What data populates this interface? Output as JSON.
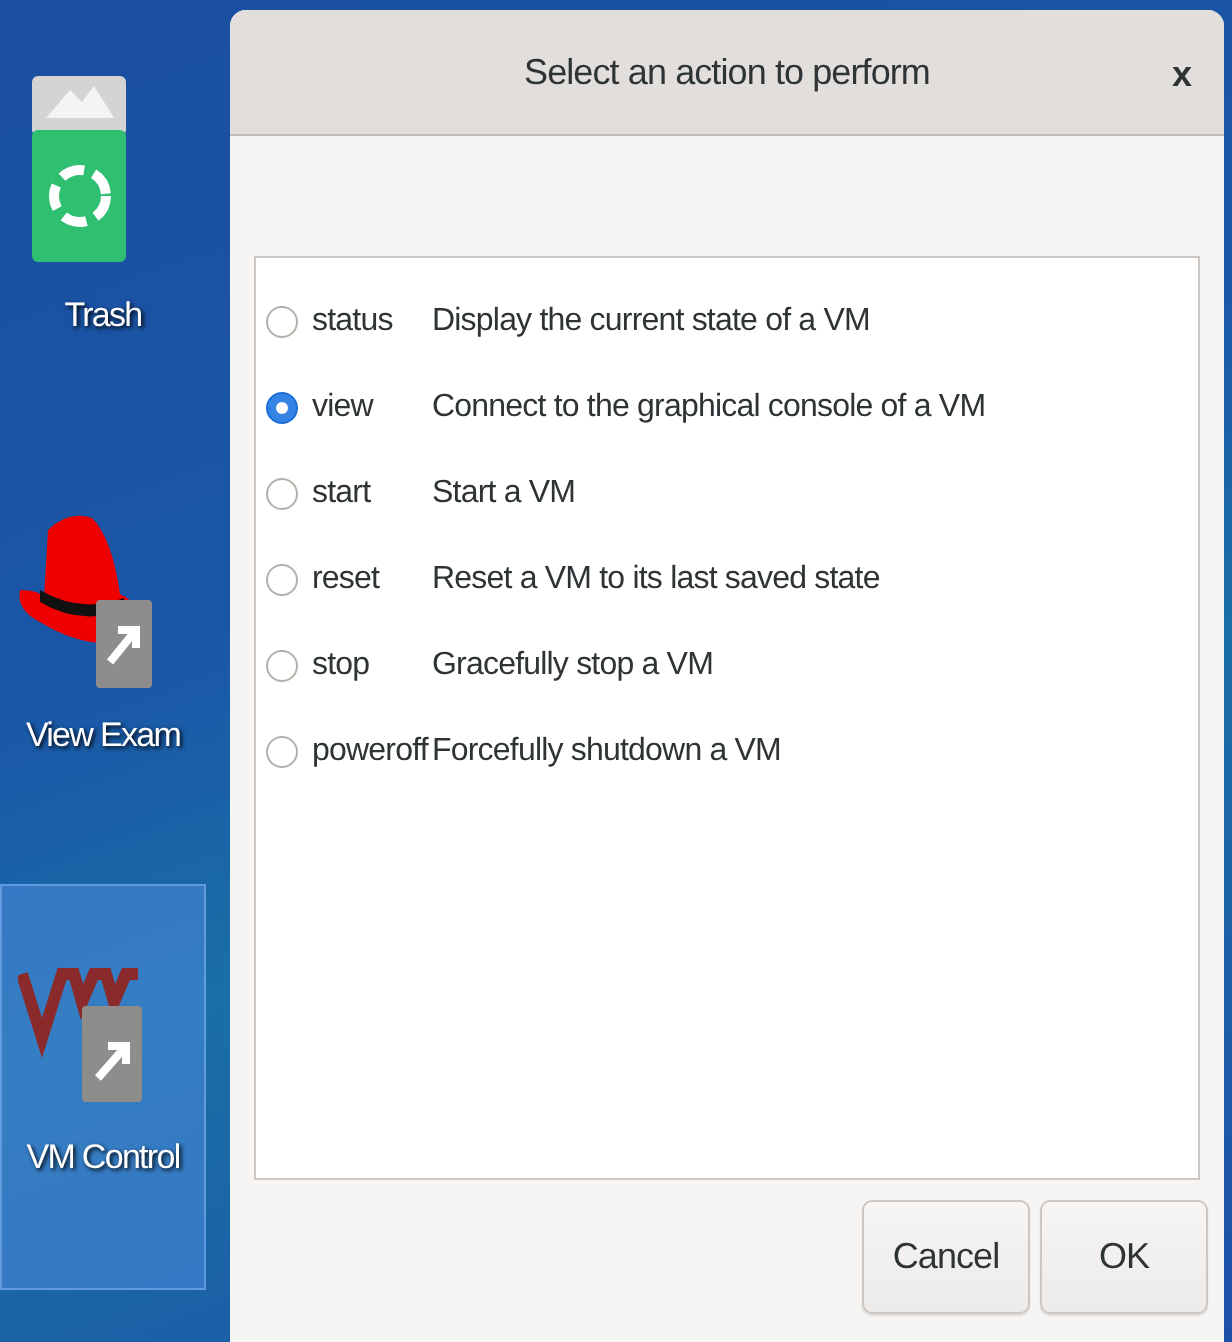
{
  "desktop_icons": [
    {
      "kind": "trash",
      "label": "Trash",
      "selected": false
    },
    {
      "kind": "hat",
      "label": "View Exam",
      "selected": false
    },
    {
      "kind": "vm",
      "label": "VM Control",
      "selected": true
    }
  ],
  "dialog": {
    "title": "Select an action to perform",
    "close": "x",
    "options": [
      {
        "name": "status",
        "description": "Display the current state of a VM",
        "selected": false
      },
      {
        "name": "view",
        "description": "Connect to the graphical console of a VM",
        "selected": true
      },
      {
        "name": "start",
        "description": "Start a VM",
        "selected": false
      },
      {
        "name": "reset",
        "description": "Reset a VM to its last saved state",
        "selected": false
      },
      {
        "name": "stop",
        "description": "Gracefully stop a VM",
        "selected": false
      },
      {
        "name": "poweroff",
        "description": "Forcefully shutdown a VM",
        "selected": false
      }
    ],
    "buttons": [
      "Cancel",
      "OK"
    ]
  }
}
